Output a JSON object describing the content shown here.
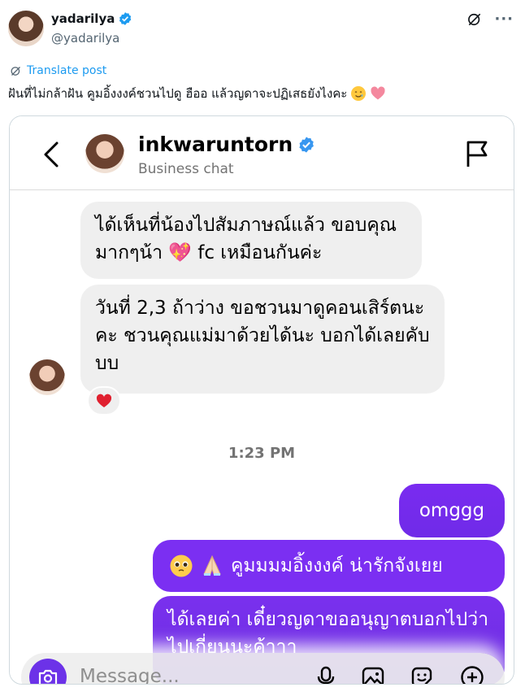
{
  "tweet": {
    "display_name": "yadarilya",
    "handle": "@yadarilya",
    "translate_label": "Translate post",
    "text": "ฝันที่ไม่กล้าฝัน คูมอิ้งงงค์ชวนไปดู ฮืออ แล้วญดาจะปฏิเสธยังไงคะ",
    "accent_color": "#1d9bf0",
    "icons": [
      "verified-badge-icon",
      "grok-icon",
      "more-icon",
      "translate-icon",
      "smiling-tear-emoji",
      "pink-heart-emoji"
    ]
  },
  "chat": {
    "contact_name": "inkwaruntorn",
    "contact_subtitle": "Business chat",
    "messages_in": [
      {
        "text": "ได้เห็นที่น้องไปสัมภาษณ์แล้ว ขอบคุณมากๆน้า 💖 fc เหมือนกันค่ะ"
      },
      {
        "text": "วันที่ 2,3 ถ้าว่าง ขอชวนมาดูคอนเสิร์ตนะคะ ชวนคุณแม่มาด้วยได้นะ บอกได้เลยคับบบ"
      }
    ],
    "reaction": "❤️",
    "timestamp": "1:23 PM",
    "messages_out": [
      {
        "text": "omggg"
      },
      {
        "text": "คูมมมมอิ้งงงค์ น่ารักจังเยย"
      },
      {
        "text": "ได้เลยค่า เดี๋ยวญดาขออนุญาตบอกไปว่าไปเกี่ยนนะค้าาา"
      }
    ],
    "composer_placeholder": "Message...",
    "bubble_color": "#7b2ff2",
    "icons": [
      "back-icon",
      "flag-icon",
      "camera-icon",
      "microphone-icon",
      "gallery-icon",
      "sticker-icon",
      "plus-icon",
      "pleading-face-emoji",
      "folded-hands-emoji"
    ]
  }
}
